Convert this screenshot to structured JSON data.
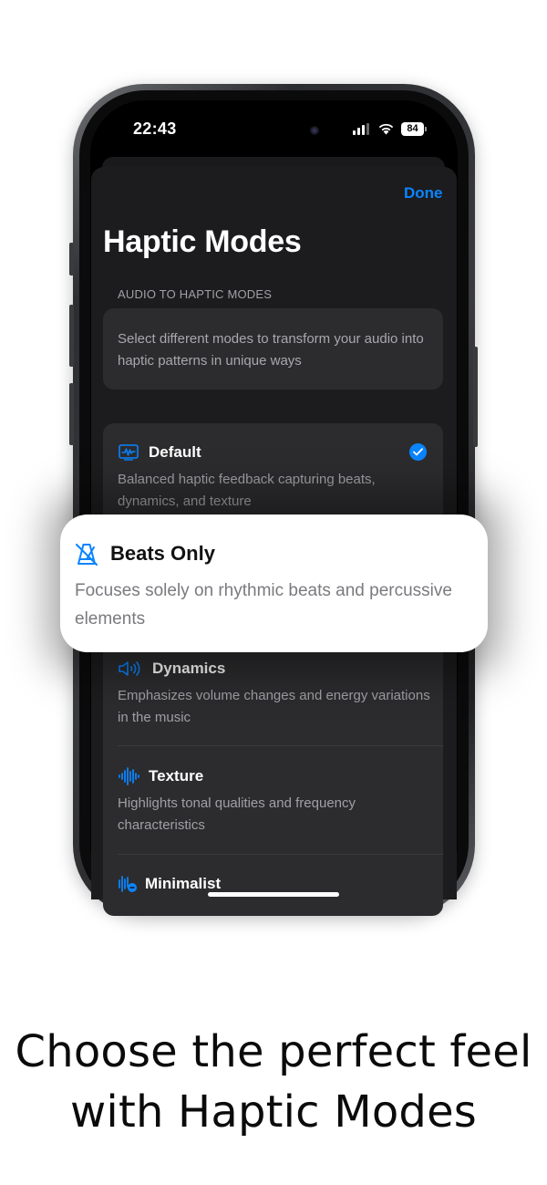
{
  "status_bar": {
    "time": "22:43",
    "battery": "84"
  },
  "sheet": {
    "done_label": "Done",
    "title": "Haptic Modes",
    "section_header": "AUDIO TO HAPTIC MODES",
    "description": "Select different modes to transform your audio into haptic patterns in unique ways"
  },
  "modes": [
    {
      "name": "Default",
      "description": "Balanced haptic feedback capturing beats, dynamics, and texture",
      "icon": "waveform-box-icon",
      "selected": true
    },
    {
      "name": "Beats Only",
      "description": "Focuses solely on rhythmic beats and percussive elements",
      "icon": "metronome-icon",
      "selected": false
    },
    {
      "name": "Dynamics",
      "description": "Emphasizes volume changes and energy variations in the music",
      "icon": "speaker-wave-icon",
      "selected": false
    },
    {
      "name": "Texture",
      "description": "Highlights tonal qualities and frequency characteristics",
      "icon": "waveform-icon",
      "selected": false
    },
    {
      "name": "Minimalist",
      "description": "",
      "icon": "waveform-minus-icon",
      "selected": false
    }
  ],
  "popout": {
    "title": "Beats Only",
    "description": "Focuses solely on rhythmic beats and percussive elements"
  },
  "caption": {
    "line1": "Choose the perfect feel",
    "line2": "with Haptic Modes"
  },
  "colors": {
    "accent": "#0a84ff",
    "sheet_bg": "#1c1c1e",
    "card_bg": "#2c2c2e",
    "caption": "#0b0b0b"
  }
}
